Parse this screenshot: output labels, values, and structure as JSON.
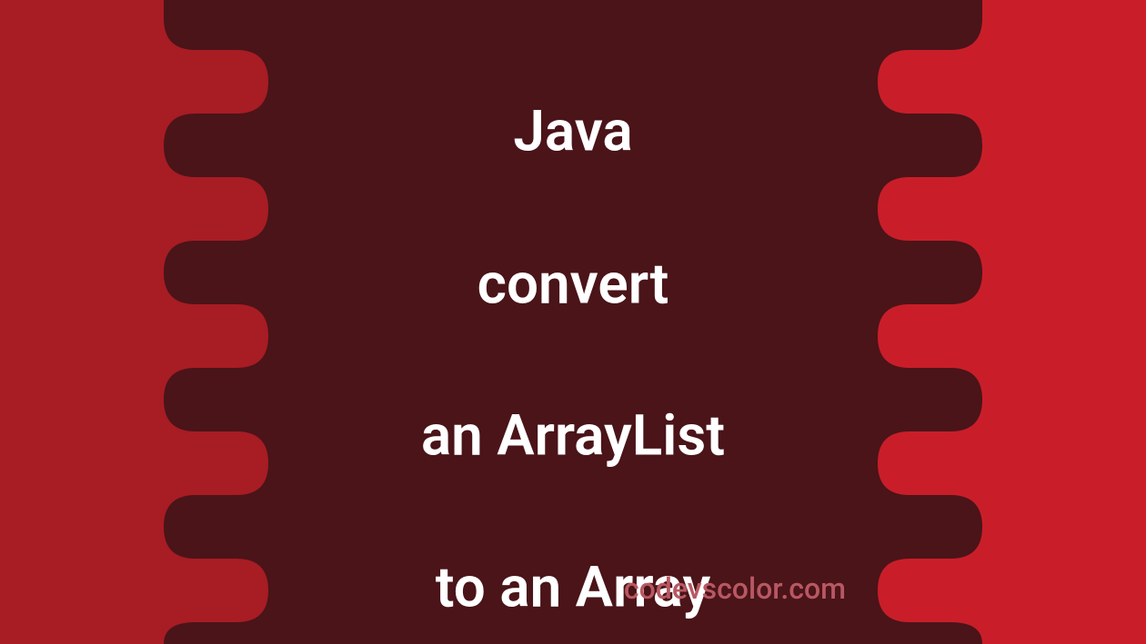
{
  "title": {
    "line1": "Java",
    "line2": "convert",
    "line3": "an ArrayList",
    "line4": "to an Array"
  },
  "watermark": "codevscolor.com",
  "colors": {
    "bg_gradient_start": "#a81c24",
    "bg_gradient_end": "#c91e29",
    "center_panel": "#4a1419",
    "title_text": "#ffffff",
    "watermark_text": "#b85862"
  }
}
